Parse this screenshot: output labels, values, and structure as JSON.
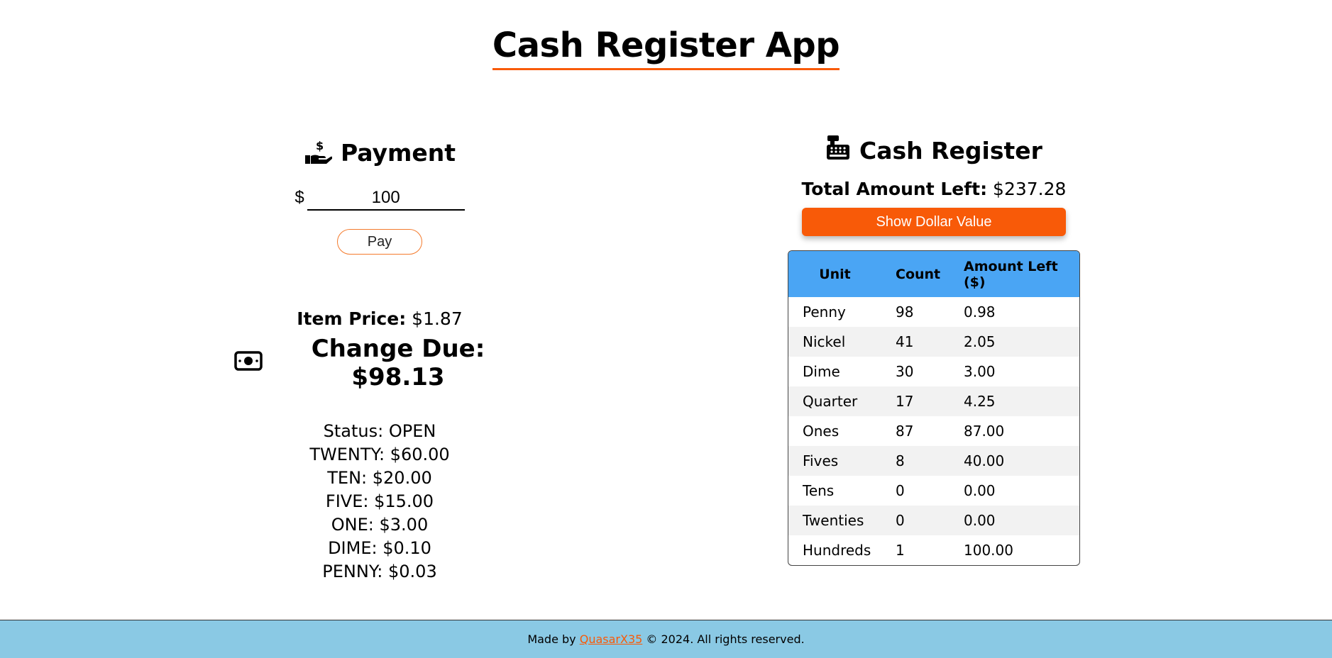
{
  "app": {
    "title": "Cash Register App"
  },
  "payment": {
    "heading": "Payment",
    "icon": "hand-holding-dollar-icon",
    "currency_symbol": "$",
    "input_value": "100",
    "pay_label": "Pay",
    "item_price_label": "Item Price:",
    "item_price_value": "$1.87",
    "change_due_label": "Change Due: $98.13",
    "change_icon": "money-bill-icon",
    "result_lines": [
      "Status: OPEN",
      "TWENTY: $60.00",
      "TEN: $20.00",
      "FIVE: $15.00",
      "ONE: $3.00",
      "DIME: $0.10",
      "PENNY: $0.03"
    ]
  },
  "register": {
    "heading": "Cash Register",
    "icon": "cash-register-icon",
    "total_label": "Total Amount Left:",
    "total_value": "$237.28",
    "show_button_label": "Show Dollar Value",
    "columns": [
      "Unit",
      "Count",
      "Amount Left ($)"
    ],
    "rows": [
      [
        "Penny",
        "98",
        "0.98"
      ],
      [
        "Nickel",
        "41",
        "2.05"
      ],
      [
        "Dime",
        "30",
        "3.00"
      ],
      [
        "Quarter",
        "17",
        "4.25"
      ],
      [
        "Ones",
        "87",
        "87.00"
      ],
      [
        "Fives",
        "8",
        "40.00"
      ],
      [
        "Tens",
        "0",
        "0.00"
      ],
      [
        "Twenties",
        "0",
        "0.00"
      ],
      [
        "Hundreds",
        "1",
        "100.00"
      ]
    ]
  },
  "footer": {
    "prefix": "Made by ",
    "author": "QuasarX35",
    "suffix": " © 2024. All rights reserved."
  },
  "colors": {
    "accent": "#f85a08",
    "table_header": "#4aa5f4",
    "footer_bg": "#8ac9e4"
  }
}
